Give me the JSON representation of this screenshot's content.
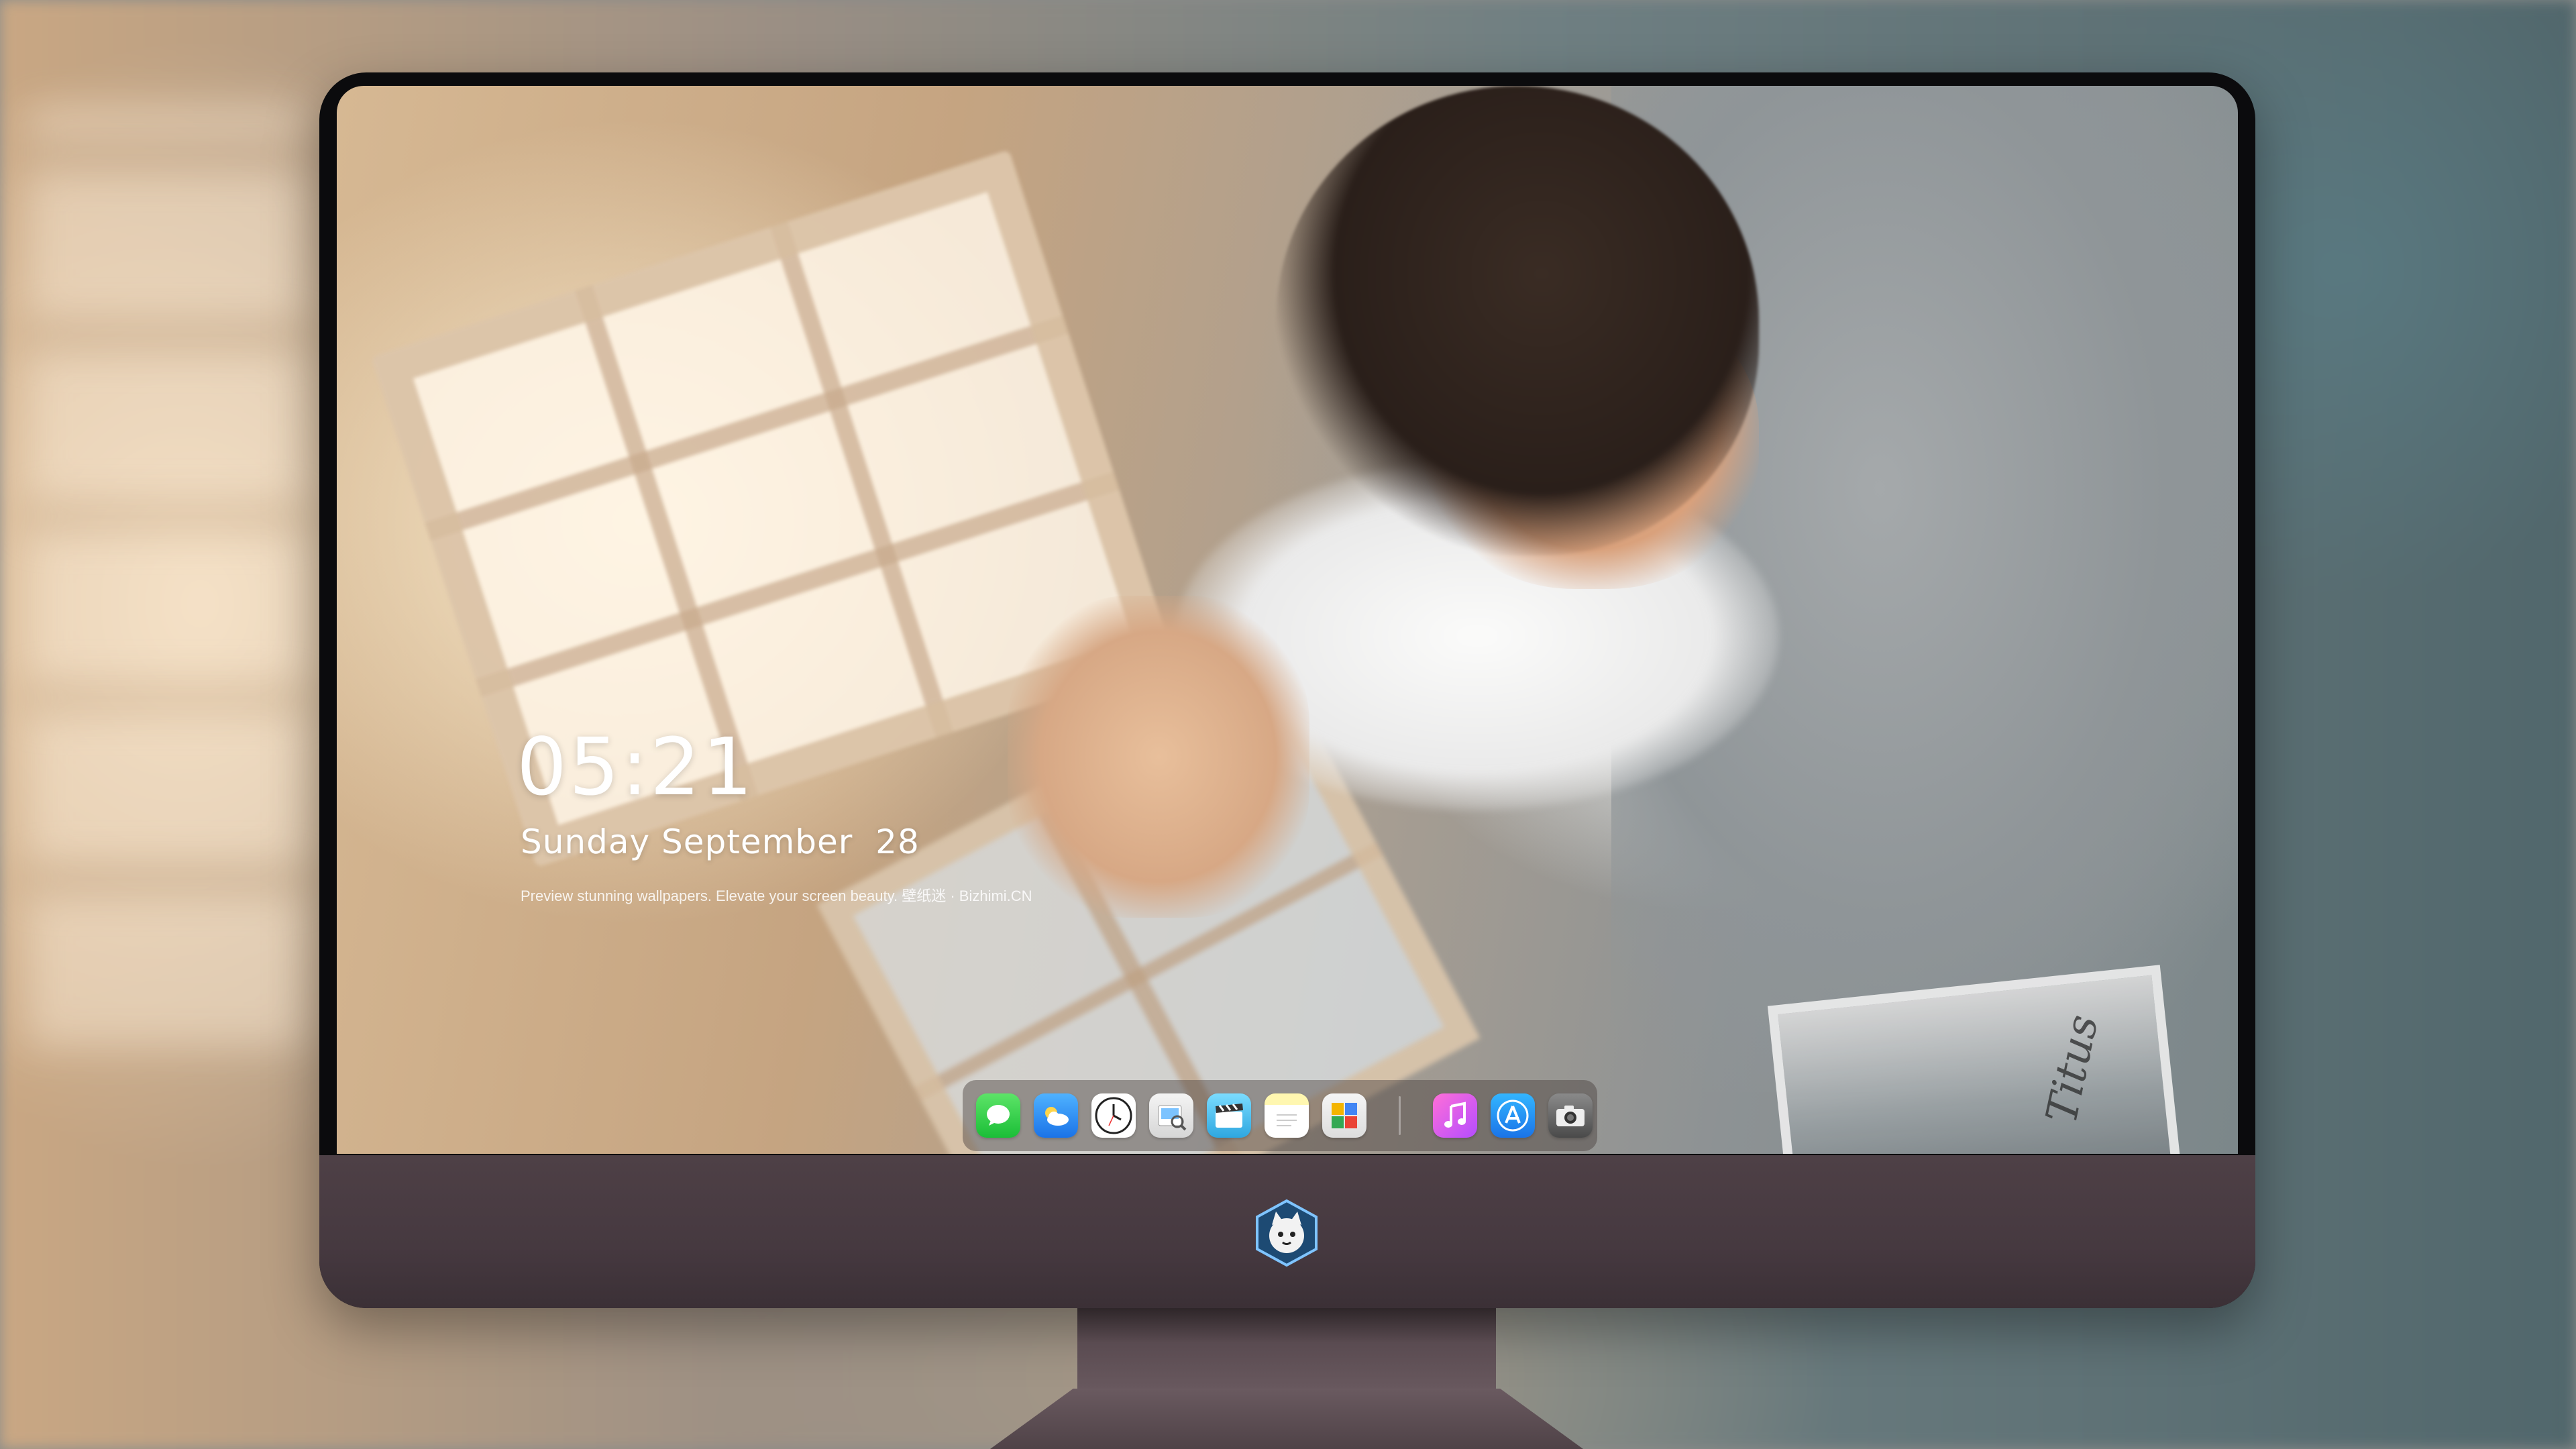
{
  "lock_screen": {
    "time": "05:21",
    "date": "Sunday September  28",
    "tagline": "Preview stunning wallpapers. Elevate your screen beauty. 壁纸迷 · Bizhimi.CN"
  },
  "wallpaper": {
    "photo_caption": "Titus"
  },
  "dock": {
    "apps": [
      {
        "name": "Messages",
        "icon": "messages-icon"
      },
      {
        "name": "Weather",
        "icon": "weather-icon"
      },
      {
        "name": "Clock",
        "icon": "clock-icon"
      },
      {
        "name": "Preview",
        "icon": "preview-icon"
      },
      {
        "name": "Video",
        "icon": "clapperboard-icon"
      },
      {
        "name": "Notes",
        "icon": "notes-icon"
      },
      {
        "name": "Photos",
        "icon": "photos-icon"
      },
      {
        "name": "Music",
        "icon": "music-note-icon"
      },
      {
        "name": "App Store",
        "icon": "app-store-icon"
      },
      {
        "name": "Camera",
        "icon": "camera-icon"
      }
    ]
  },
  "colors": {
    "chin": "#463940",
    "bezel": "#0b0b0d",
    "clock_text": "#ffffff"
  }
}
